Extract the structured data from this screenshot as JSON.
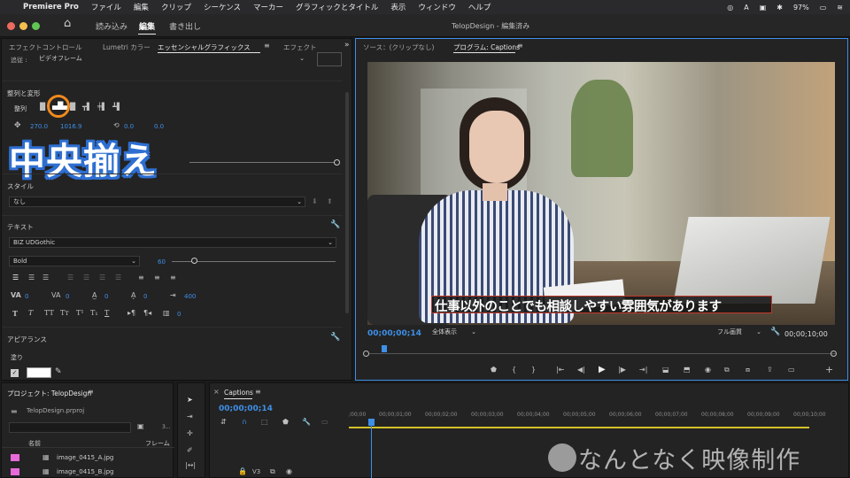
{
  "menubar": {
    "apple": "",
    "app": "Premiere Pro",
    "items": [
      "ファイル",
      "編集",
      "クリップ",
      "シーケンス",
      "マーカー",
      "グラフィックとタイトル",
      "表示",
      "ウィンドウ",
      "ヘルプ"
    ],
    "battery": "97%",
    "clock_icons": [
      "cc-icon",
      "a-icon",
      "display-icon",
      "bluetooth-icon",
      "battery-icon",
      "wifi-icon"
    ]
  },
  "titlebar": {
    "home": "⌂",
    "workspaces": [
      "読み込み",
      "編集",
      "書き出し"
    ],
    "active_workspace": "編集",
    "title": "TelopDesign - 編集済み"
  },
  "left_panel": {
    "tabs": [
      "エフェクトコントロール",
      "Lumetri カラー",
      "エッセンシャルグラフィックス",
      "エフェクト"
    ],
    "active_tab": "エッセンシャルグラフィックス",
    "follow_label": "追従 :",
    "follow_value": "ビデオフレーム",
    "align_section": "整列と変形",
    "align_label": "整列",
    "pos_x": "270.0",
    "pos_y": "1016.9",
    "rot": "0.0",
    "anchor": "0.0",
    "overlay_text": "中央揃え",
    "style_section": "スタイル",
    "style_value": "なし",
    "text_section": "テキスト",
    "font_name": "BIZ UDGothic",
    "font_style": "Bold",
    "font_size": "60",
    "kerning": "0",
    "tracking": "0",
    "leading": "0",
    "baseline": "0",
    "tsume": "0",
    "tab_width": "400",
    "underline_val": "0",
    "appearance_section": "アピアランス",
    "fill_label": "塗り"
  },
  "program_monitor": {
    "tabs": [
      "ソース：(クリップなし)",
      "プログラム: Captions"
    ],
    "active_tab": "プログラム: Captions",
    "caption": "仕事以外のことでも相談しやすい雰囲気があります",
    "timecode": "00;00;00;14",
    "zoom": "全体表示",
    "quality": "フル画質",
    "duration": "00;00;10;00"
  },
  "project_panel": {
    "title": "プロジェクト: TelopDesign",
    "file": "TelopDesign.prproj",
    "count": "3...",
    "col_name": "名前",
    "col_frame": "フレーム",
    "items": [
      "image_0415_A.jpg",
      "image_0415_B.jpg"
    ]
  },
  "timeline": {
    "tab": "Captions",
    "timecode": "00;00;00;14",
    "ruler": [
      ";00;00",
      "00;00;01;00",
      "00;00;02;00",
      "00;00;03;00",
      "00;00;04;00",
      "00;00;05;00",
      "00;00;06;00",
      "00;00;07;00",
      "00;00;08;00",
      "00;00;09;00",
      "00;00;10;00"
    ],
    "track": "V3"
  },
  "watermark": "なんとなく映像制作",
  "colors": {
    "accent": "#3e8fe8",
    "overlay_stroke": "#2e6fd1",
    "highlight_ring": "#f08a1e",
    "project_swatch": "#e86ad8"
  }
}
